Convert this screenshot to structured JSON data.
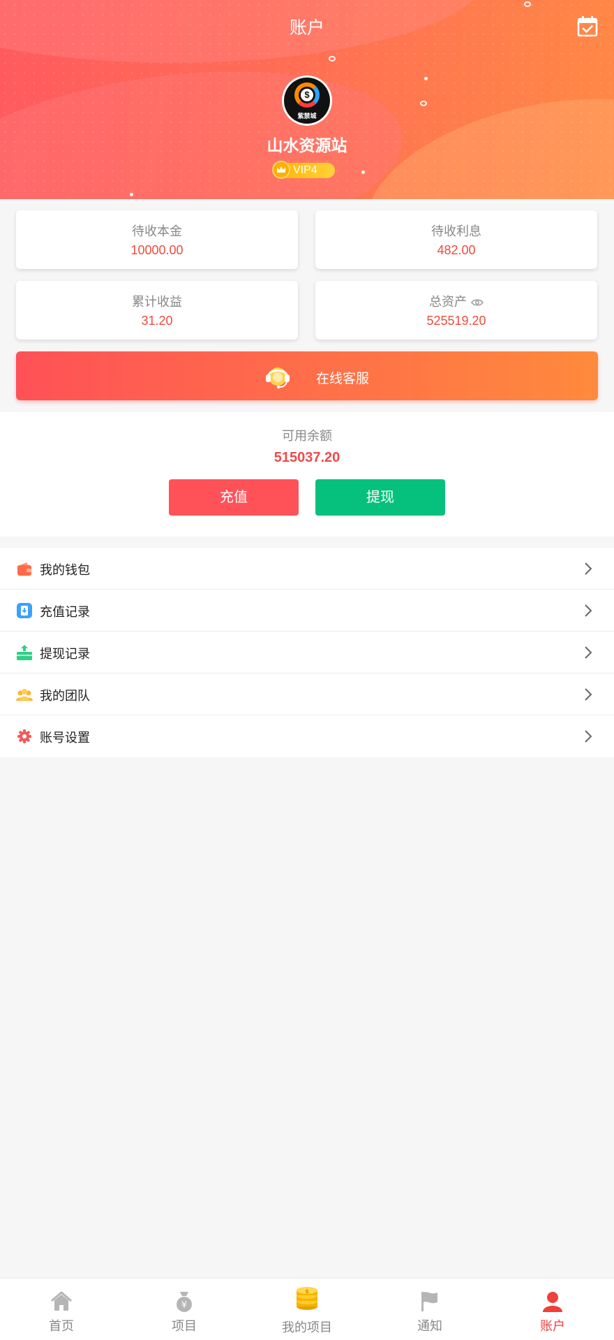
{
  "header": {
    "title": "账户",
    "calendar_icon": "calendar-check-icon",
    "avatar_text": "紫禁城",
    "user_name": "山水资源站",
    "vip_level": "VIP4"
  },
  "stats": [
    {
      "label": "待收本金",
      "value": "10000.00"
    },
    {
      "label": "待收利息",
      "value": "482.00"
    },
    {
      "label": "累计收益",
      "value": "31.20"
    },
    {
      "label": "总资产",
      "value": "525519.20"
    }
  ],
  "service": {
    "label": "在线客服",
    "icon": "headset-icon"
  },
  "balance": {
    "label": "可用余额",
    "value": "515037.20",
    "recharge_label": "充值",
    "withdraw_label": "提现"
  },
  "menu": [
    {
      "label": "我的钱包",
      "icon": "wallet-icon"
    },
    {
      "label": "充值记录",
      "icon": "recharge-record-icon"
    },
    {
      "label": "提现记录",
      "icon": "withdraw-record-icon"
    },
    {
      "label": "我的团队",
      "icon": "team-icon"
    },
    {
      "label": "账号设置",
      "icon": "settings-icon"
    }
  ],
  "nav": [
    {
      "label": "首页",
      "icon": "home-icon"
    },
    {
      "label": "项目",
      "icon": "money-bag-icon"
    },
    {
      "label": "我的项目",
      "icon": "coins-icon"
    },
    {
      "label": "通知",
      "icon": "flag-icon"
    },
    {
      "label": "账户",
      "icon": "user-icon"
    }
  ],
  "colors": {
    "accent": "#f04a3a",
    "recharge": "#ff5258",
    "withdraw": "#06c17d"
  }
}
